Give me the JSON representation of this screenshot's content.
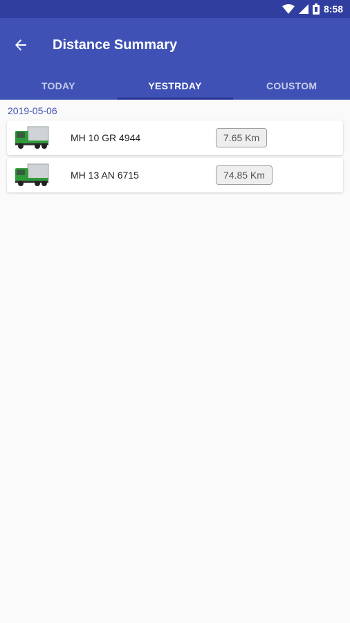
{
  "status": {
    "time": "8:58",
    "wifi_icon": "wifi-icon",
    "signal_icon": "signal-icon",
    "battery_icon": "battery-icon"
  },
  "app_bar": {
    "title": "Distance Summary",
    "back_icon": "back-arrow-icon"
  },
  "tabs": [
    {
      "label": "TODAY",
      "active": false
    },
    {
      "label": "YESTRDAY",
      "active": true
    },
    {
      "label": "COUSTOM",
      "active": false
    }
  ],
  "date": "2019-05-06",
  "vehicles": [
    {
      "number": "MH 10 GR 4944",
      "distance": "7.65 Km",
      "icon": "truck-icon"
    },
    {
      "number": "MH 13 AN 6715",
      "distance": "74.85 Km",
      "icon": "truck-icon"
    }
  ],
  "colors": {
    "primary": "#3f51b5",
    "primary_dark": "#303f9f",
    "truck_green": "#2e9a3a"
  }
}
